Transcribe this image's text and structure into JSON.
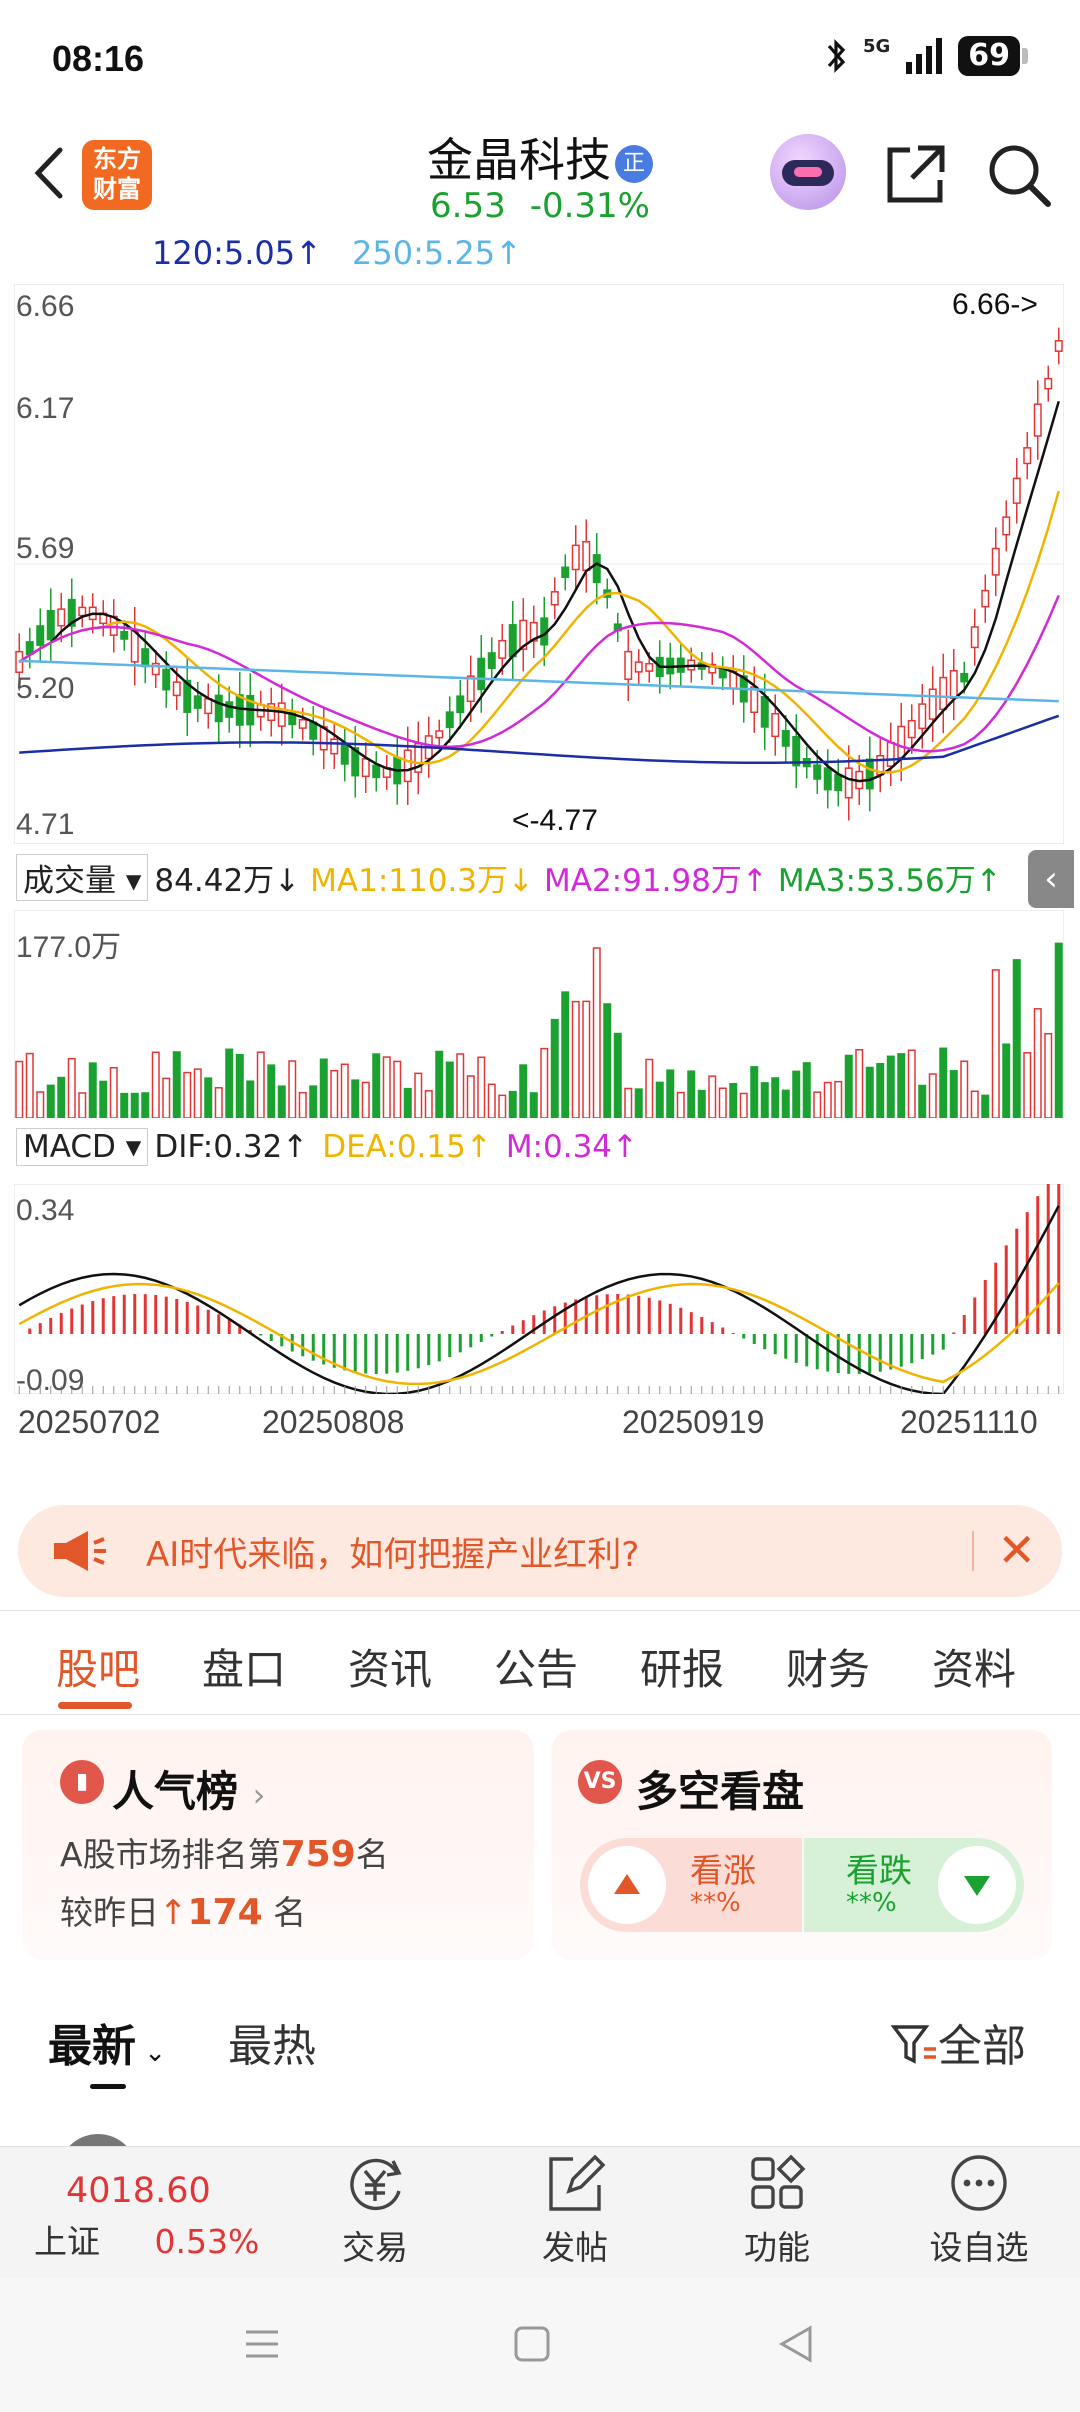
{
  "status_bar": {
    "time": "08:16",
    "signal": "5G",
    "battery": "69"
  },
  "header": {
    "logo_line1": "东方",
    "logo_line2": "财富",
    "stock_name": "金晶科技",
    "stock_tag": "正",
    "price": "6.53",
    "change_pct": "-0.31%"
  },
  "chart": {
    "ma_top": {
      "ma120": "120:5.05↑",
      "ma250": "250:5.25↑"
    },
    "price_axis": {
      "top": "6.66",
      "mid1": "6.17",
      "mid2": "5.69",
      "mid3": "5.20",
      "bottom": "4.71"
    },
    "max_marker": "6.66->",
    "min_marker": "<-4.77",
    "volume_row": {
      "selector": "成交量",
      "value": "84.42万↓",
      "ma1": "MA1:110.3万↓",
      "ma2": "MA2:91.98万↑",
      "ma3": "MA3:53.56万↑",
      "axis_top": "177.0万"
    },
    "macd_row": {
      "selector": "MACD",
      "dif": "DIF:0.32↑",
      "dea": "DEA:0.15↑",
      "m": "M:0.34↑",
      "axis_top": "0.34",
      "axis_bottom": "-0.09"
    },
    "dates": [
      "20250702",
      "20250808",
      "20250919",
      "20251110"
    ],
    "colors": {
      "up": "#e23636",
      "down": "#1aa130",
      "ma_yellow": "#f0b400",
      "ma_magenta": "#d12ad6",
      "ma_green": "#1aa130",
      "ma_blue": "#1a2ea6",
      "ma_light": "#5bb5e6"
    },
    "collapse_icon": "chevron-left-icon"
  },
  "banner": {
    "text": "AI时代来临，如何把握产业红利?"
  },
  "tabs": [
    "股吧",
    "盘口",
    "资讯",
    "公告",
    "研报",
    "财务",
    "资料"
  ],
  "cards": {
    "popularity": {
      "title": "人气榜",
      "line1_prefix": "A股市场排名第",
      "rank": "759",
      "line1_suffix": "名",
      "line2_prefix": "较昨日",
      "change": "174",
      "line2_suffix": "名"
    },
    "bull_bear": {
      "title": "多空看盘",
      "bull_label": "看涨",
      "bull_value": "**%",
      "bear_label": "看跌",
      "bear_value": "**%"
    }
  },
  "feed_filter": {
    "latest": "最新",
    "hot": "最热",
    "all": "全部"
  },
  "bottom_nav": {
    "index_value": "4018.60",
    "index_name": "上证",
    "index_change": "0.53%",
    "items": [
      "交易",
      "发帖",
      "功能",
      "设自选"
    ]
  }
}
